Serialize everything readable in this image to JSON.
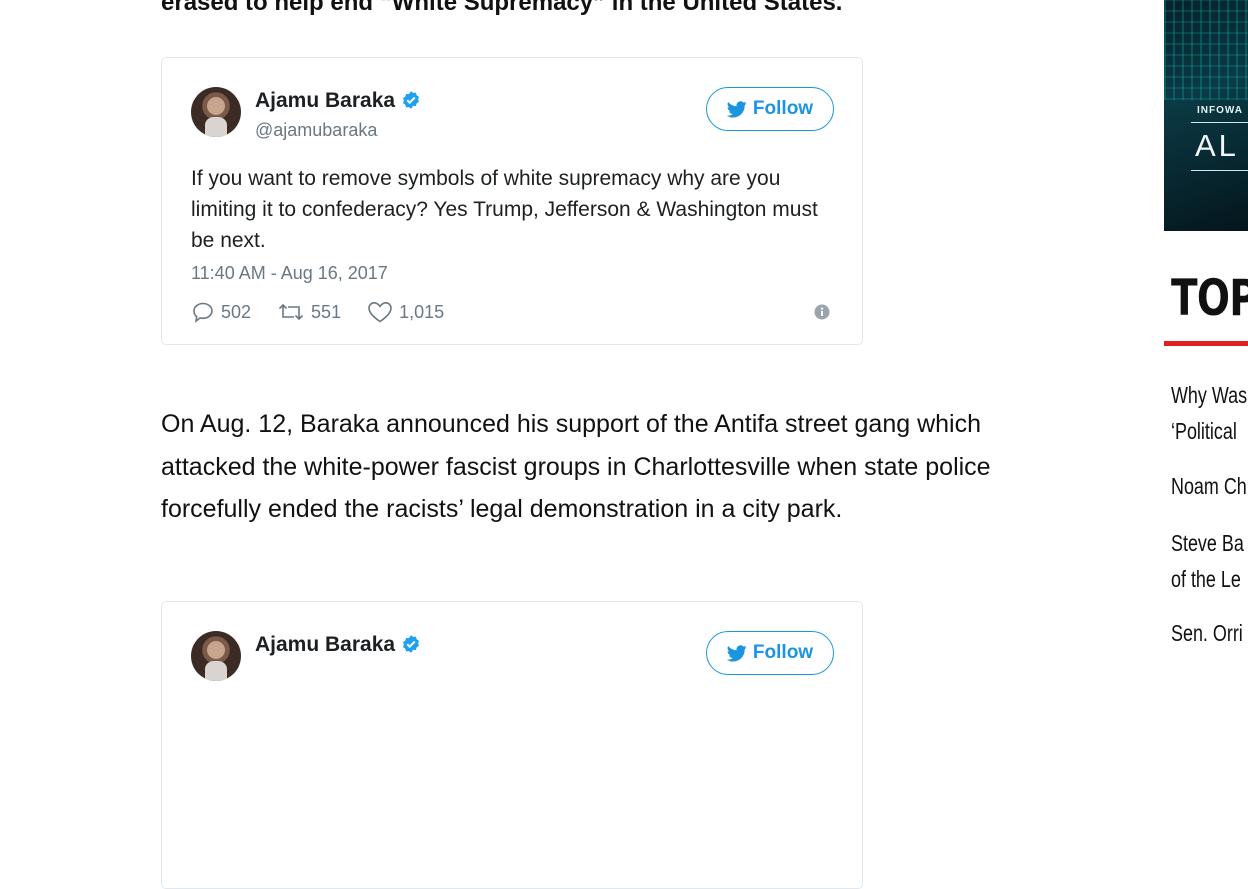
{
  "article": {
    "headline_fragment": "erased to help end “White Supremacy” in the United States.",
    "paragraph": "On Aug. 12, Baraka announced his support of the Antifa street gang which attacked the white-power fascist groups in Charlottesville when state police forcefully ended the racists’ legal demonstration in a city park."
  },
  "tweets": [
    {
      "display_name": "Ajamu Baraka",
      "handle": "@ajamubaraka",
      "follow_label": "Follow",
      "text": "If you want to remove symbols of white supremacy why are you limiting it to confederacy? Yes Trump, Jefferson & Washington must be next.",
      "timestamp": "11:40 AM - Aug 16, 2017",
      "replies": "502",
      "retweets": "551",
      "likes": "1,015"
    },
    {
      "display_name": "Ajamu Baraka",
      "follow_label": "Follow"
    }
  ],
  "sidebar": {
    "ad": {
      "small_text": "INFOWA",
      "big_text": "AL"
    },
    "heading": "TOP",
    "links": [
      {
        "line1": "Why Was",
        "line2": "‘Political"
      },
      {
        "line1": "Noam Ch"
      },
      {
        "line1": "Steve Ba",
        "line2": "of the Le"
      },
      {
        "line1": "Sen. Orri"
      }
    ]
  },
  "colors": {
    "twitter_blue": "#1b95e0",
    "verified_blue": "#1da1f2",
    "muted_gray": "#697882",
    "accent_red": "#e02020"
  }
}
